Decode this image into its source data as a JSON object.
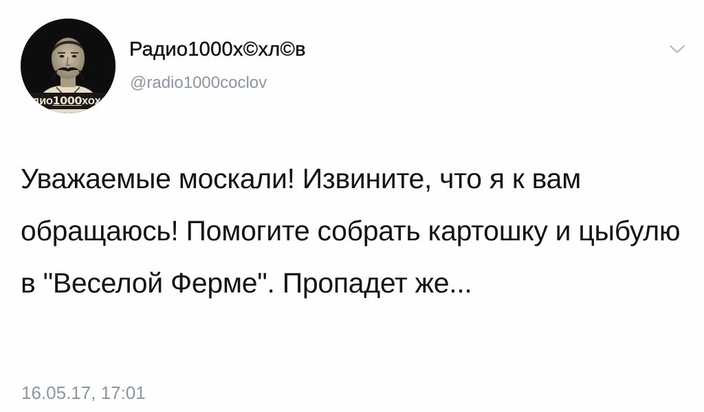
{
  "tweet": {
    "author": {
      "display_name": "Радио1000х©хл©в",
      "handle": "@radio1000coclov",
      "avatar_banner_prefix": "РАДИО",
      "avatar_banner_number": "1000",
      "avatar_banner_suffix": "ХОХЛОВ"
    },
    "text": "Уважаемые москали! Извините, что я к вам обращаюсь! Помогите собрать картошку и цыбулю в \"Веселой Ферме\". Пропадет же...",
    "timestamp": "16.05.17, 17:01",
    "menu_icon": "chevron-down-icon",
    "colors": {
      "secondary_text": "#8a96a3",
      "primary_text": "#141414",
      "avatar_bg": "#0d0d0d"
    }
  }
}
